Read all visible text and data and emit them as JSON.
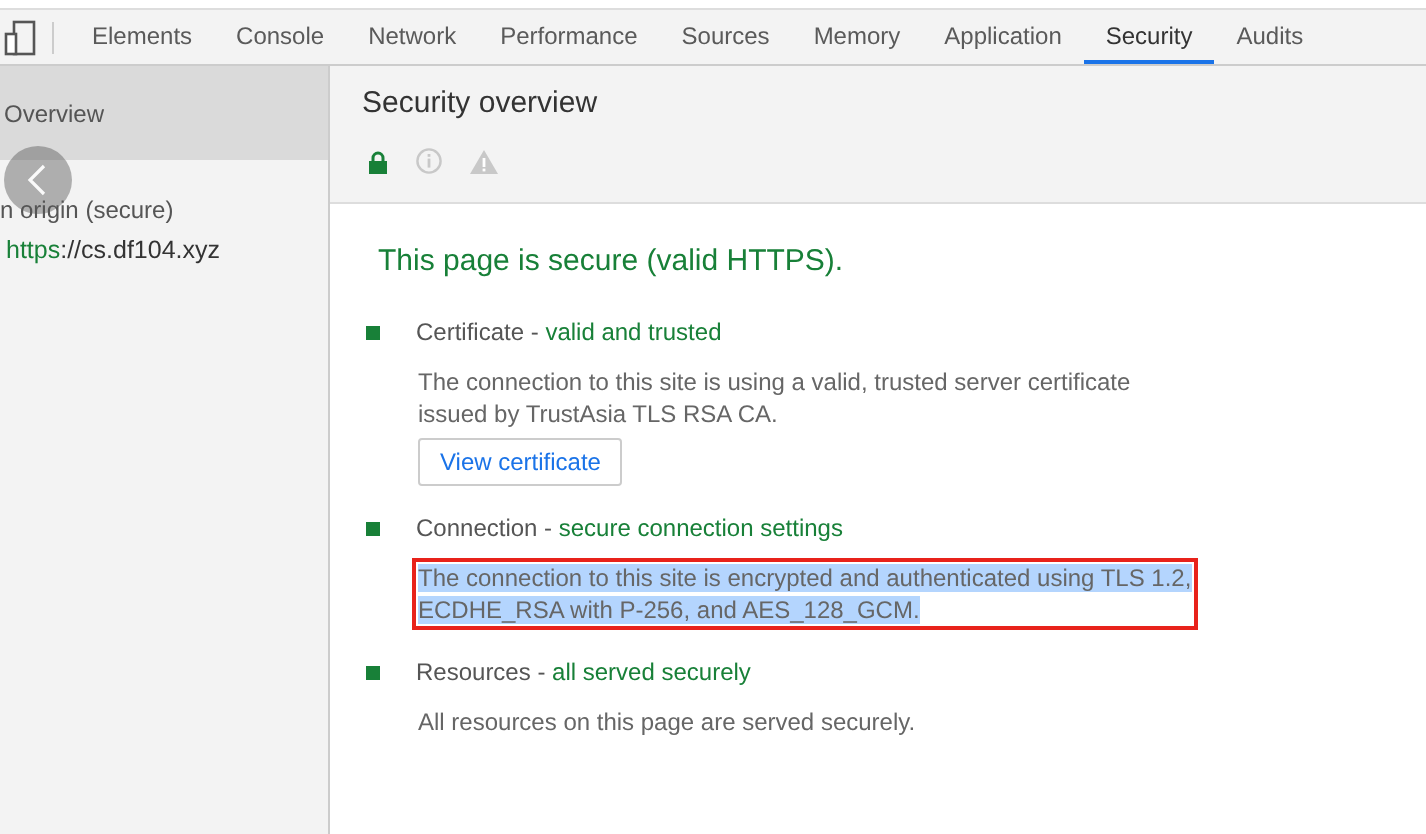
{
  "tabs": [
    {
      "label": "Elements",
      "selected": false
    },
    {
      "label": "Console",
      "selected": false
    },
    {
      "label": "Network",
      "selected": false
    },
    {
      "label": "Performance",
      "selected": false
    },
    {
      "label": "Sources",
      "selected": false
    },
    {
      "label": "Memory",
      "selected": false
    },
    {
      "label": "Application",
      "selected": false
    },
    {
      "label": "Security",
      "selected": true
    },
    {
      "label": "Audits",
      "selected": false
    }
  ],
  "sidebar": {
    "items": [
      {
        "kind": "overview",
        "label": "Overview",
        "selected": true
      },
      {
        "kind": "heading",
        "label": "n origin (secure)",
        "selected": false
      },
      {
        "kind": "origin",
        "scheme": "https",
        "host": "://cs.df104.xyz",
        "selected": false
      }
    ]
  },
  "main": {
    "title": "Security overview",
    "summary": "This page is secure (valid HTTPS).",
    "sections": [
      {
        "title": "Certificate",
        "separator": "-",
        "status": "valid and trusted",
        "description": "The connection to this site is using a valid, trusted server certificate issued by TrustAsia TLS RSA CA.",
        "highlighted": false,
        "button": "View certificate"
      },
      {
        "title": "Connection",
        "separator": "-",
        "status": "secure connection settings",
        "description": "The connection to this site is encrypted and authenticated using TLS 1.2, ECDHE_RSA with P-256, and AES_128_GCM.",
        "highlighted": true
      },
      {
        "title": "Resources",
        "separator": "-",
        "status": "all served securely",
        "description": "All resources on this page are served securely.",
        "highlighted": false
      }
    ]
  }
}
